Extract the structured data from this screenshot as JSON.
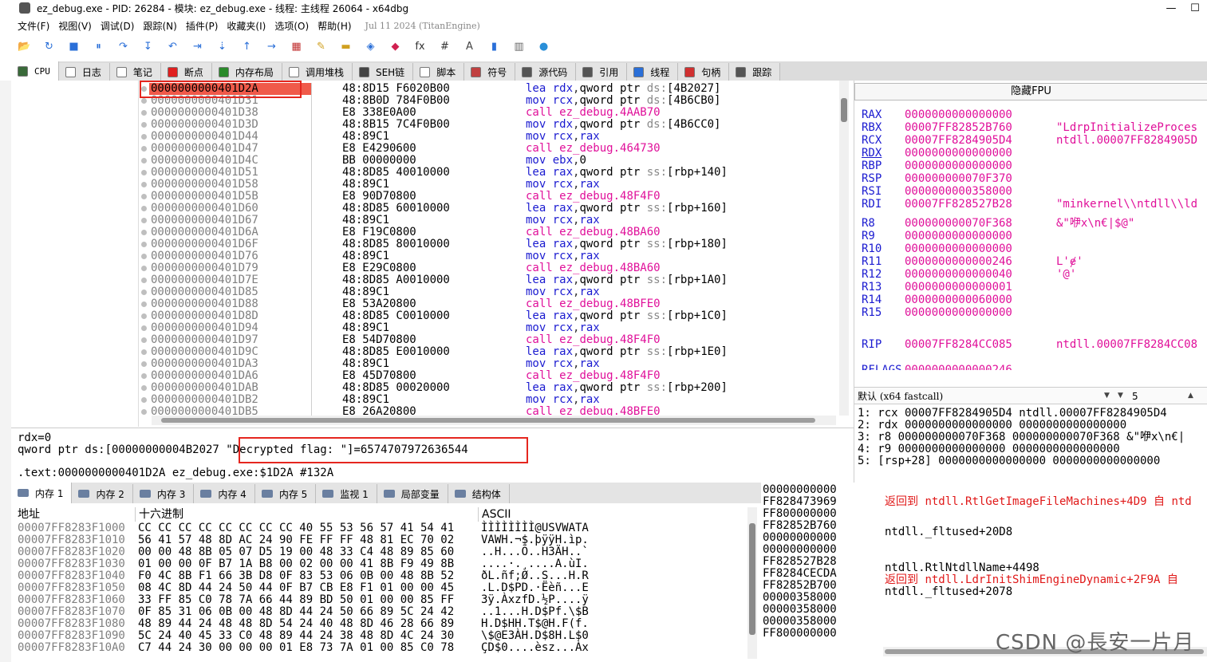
{
  "window": {
    "title": "ez_debug.exe - PID: 26284 - 模块: ez_debug.exe - 线程: 主线程 26064 - x64dbg",
    "minimize_glyph": "—",
    "maximize_glyph": "☐"
  },
  "menu": {
    "items": [
      "文件(F)",
      "视图(V)",
      "调试(D)",
      "跟踪(N)",
      "插件(P)",
      "收藏夹(I)",
      "选项(O)",
      "帮助(H)"
    ],
    "date": "Jul 11 2024 (TitanEngine)"
  },
  "toolbar": {
    "icons": [
      "open-icon",
      "restart-icon",
      "stop-icon",
      "pause-icon",
      "step-over-icon",
      "step-into-icon",
      "step-back-icon",
      "trace-over-icon",
      "trace-into-icon",
      "run-to-user-icon",
      "animate-icon",
      "patch-icon",
      "comment-icon",
      "label-icon",
      "bookmark-icon",
      "function-icon",
      "fx-icon",
      "hash-icon",
      "font-icon",
      "script-icon",
      "calc-icon",
      "globe-icon"
    ],
    "glyphs": [
      "📂",
      "↻",
      "■",
      "⏸",
      "↷",
      "↧",
      "↶",
      "⇥",
      "⇣",
      "↑",
      "→",
      "▦",
      "✎",
      "▬",
      "◈",
      "◆",
      "fx",
      "#",
      "A",
      "▮",
      "▥",
      "●"
    ],
    "colors": [
      "#d89b2a",
      "#2a6fd8",
      "#2a6fd8",
      "#2a6fd8",
      "#2a6fd8",
      "#2a6fd8",
      "#2a6fd8",
      "#2a6fd8",
      "#2a6fd8",
      "#2a6fd8",
      "#2a6fd8",
      "#c03030",
      "#d0a020",
      "#d0a020",
      "#2a6fd8",
      "#d02050",
      "#333333",
      "#333333",
      "#444444",
      "#2a6fd8",
      "#666666",
      "#2a8fd8"
    ]
  },
  "tabs": [
    {
      "label": "CPU",
      "icon": "cpu-icon",
      "color": "#3a6a3a",
      "active": true
    },
    {
      "label": "日志",
      "icon": "log-icon",
      "color": "#ffffff"
    },
    {
      "label": "笔记",
      "icon": "notes-icon",
      "color": "#ffffff"
    },
    {
      "label": "断点",
      "icon": "breakpoint-icon",
      "color": "#e02020"
    },
    {
      "label": "内存布局",
      "icon": "memory-map-icon",
      "color": "#2a8a2a"
    },
    {
      "label": "调用堆栈",
      "icon": "call-stack-icon",
      "color": "#ffffff"
    },
    {
      "label": "SEH链",
      "icon": "seh-icon",
      "color": "#444444"
    },
    {
      "label": "脚本",
      "icon": "script-icon",
      "color": "#ffffff"
    },
    {
      "label": "符号",
      "icon": "symbols-icon",
      "color": "#c04040"
    },
    {
      "label": "源代码",
      "icon": "source-icon",
      "color": "#555555"
    },
    {
      "label": "引用",
      "icon": "references-icon",
      "color": "#555555"
    },
    {
      "label": "线程",
      "icon": "threads-icon",
      "color": "#2a6fd8"
    },
    {
      "label": "句柄",
      "icon": "handles-icon",
      "color": "#d03030"
    },
    {
      "label": "跟踪",
      "icon": "trace-icon",
      "color": "#555555"
    }
  ],
  "disasm": {
    "rows": [
      {
        "addr": "0000000000401D2A",
        "bytes": "48:8D15 F6020B00",
        "op": "lea",
        "args": [
          [
            "reg",
            "rdx"
          ],
          [
            "p",
            ","
          ],
          [
            "ptr",
            "qword ptr "
          ],
          [
            "seg",
            "ds:"
          ],
          [
            "mem",
            "[4B2027]"
          ]
        ],
        "selected": true
      },
      {
        "addr": "0000000000401D31",
        "bytes": "48:8B0D 784F0B00",
        "op": "mov",
        "args": [
          [
            "reg",
            "rcx"
          ],
          [
            "p",
            ","
          ],
          [
            "ptr",
            "qword ptr "
          ],
          [
            "seg",
            "ds:"
          ],
          [
            "mem",
            "[4B6CB0]"
          ]
        ]
      },
      {
        "addr": "0000000000401D38",
        "bytes": "E8 338E0A00",
        "op": "call",
        "args": [
          [
            "tgt",
            "ez_debug.4AAB70"
          ]
        ]
      },
      {
        "addr": "0000000000401D3D",
        "bytes": "48:8B15 7C4F0B00",
        "op": "mov",
        "args": [
          [
            "reg",
            "rdx"
          ],
          [
            "p",
            ","
          ],
          [
            "ptr",
            "qword ptr "
          ],
          [
            "seg",
            "ds:"
          ],
          [
            "mem",
            "[4B6CC0]"
          ]
        ]
      },
      {
        "addr": "0000000000401D44",
        "bytes": "48:89C1",
        "op": "mov",
        "args": [
          [
            "reg",
            "rcx"
          ],
          [
            "p",
            ","
          ],
          [
            "reg",
            "rax"
          ]
        ]
      },
      {
        "addr": "0000000000401D47",
        "bytes": "E8 E4290600",
        "op": "call",
        "args": [
          [
            "tgt",
            "ez_debug.464730"
          ]
        ]
      },
      {
        "addr": "0000000000401D4C",
        "bytes": "BB 00000000",
        "op": "mov",
        "args": [
          [
            "reg",
            "ebx"
          ],
          [
            "p",
            ","
          ],
          [
            "num",
            "0"
          ]
        ]
      },
      {
        "addr": "0000000000401D51",
        "bytes": "48:8D85 40010000",
        "op": "lea",
        "args": [
          [
            "reg",
            "rax"
          ],
          [
            "p",
            ","
          ],
          [
            "ptr",
            "qword ptr "
          ],
          [
            "seg",
            "ss:"
          ],
          [
            "mem",
            "[rbp+140]"
          ]
        ]
      },
      {
        "addr": "0000000000401D58",
        "bytes": "48:89C1",
        "op": "mov",
        "args": [
          [
            "reg",
            "rcx"
          ],
          [
            "p",
            ","
          ],
          [
            "reg",
            "rax"
          ]
        ]
      },
      {
        "addr": "0000000000401D5B",
        "bytes": "E8 90D70800",
        "op": "call",
        "args": [
          [
            "tgt",
            "ez_debug.48F4F0"
          ]
        ]
      },
      {
        "addr": "0000000000401D60",
        "bytes": "48:8D85 60010000",
        "op": "lea",
        "args": [
          [
            "reg",
            "rax"
          ],
          [
            "p",
            ","
          ],
          [
            "ptr",
            "qword ptr "
          ],
          [
            "seg",
            "ss:"
          ],
          [
            "mem",
            "[rbp+160]"
          ]
        ]
      },
      {
        "addr": "0000000000401D67",
        "bytes": "48:89C1",
        "op": "mov",
        "args": [
          [
            "reg",
            "rcx"
          ],
          [
            "p",
            ","
          ],
          [
            "reg",
            "rax"
          ]
        ]
      },
      {
        "addr": "0000000000401D6A",
        "bytes": "E8 F19C0800",
        "op": "call",
        "args": [
          [
            "tgt",
            "ez_debug.48BA60"
          ]
        ]
      },
      {
        "addr": "0000000000401D6F",
        "bytes": "48:8D85 80010000",
        "op": "lea",
        "args": [
          [
            "reg",
            "rax"
          ],
          [
            "p",
            ","
          ],
          [
            "ptr",
            "qword ptr "
          ],
          [
            "seg",
            "ss:"
          ],
          [
            "mem",
            "[rbp+180]"
          ]
        ]
      },
      {
        "addr": "0000000000401D76",
        "bytes": "48:89C1",
        "op": "mov",
        "args": [
          [
            "reg",
            "rcx"
          ],
          [
            "p",
            ","
          ],
          [
            "reg",
            "rax"
          ]
        ]
      },
      {
        "addr": "0000000000401D79",
        "bytes": "E8 E29C0800",
        "op": "call",
        "args": [
          [
            "tgt",
            "ez_debug.48BA60"
          ]
        ]
      },
      {
        "addr": "0000000000401D7E",
        "bytes": "48:8D85 A0010000",
        "op": "lea",
        "args": [
          [
            "reg",
            "rax"
          ],
          [
            "p",
            ","
          ],
          [
            "ptr",
            "qword ptr "
          ],
          [
            "seg",
            "ss:"
          ],
          [
            "mem",
            "[rbp+1A0]"
          ]
        ]
      },
      {
        "addr": "0000000000401D85",
        "bytes": "48:89C1",
        "op": "mov",
        "args": [
          [
            "reg",
            "rcx"
          ],
          [
            "p",
            ","
          ],
          [
            "reg",
            "rax"
          ]
        ]
      },
      {
        "addr": "0000000000401D88",
        "bytes": "E8 53A20800",
        "op": "call",
        "args": [
          [
            "tgt",
            "ez_debug.48BFE0"
          ]
        ]
      },
      {
        "addr": "0000000000401D8D",
        "bytes": "48:8D85 C0010000",
        "op": "lea",
        "args": [
          [
            "reg",
            "rax"
          ],
          [
            "p",
            ","
          ],
          [
            "ptr",
            "qword ptr "
          ],
          [
            "seg",
            "ss:"
          ],
          [
            "mem",
            "[rbp+1C0]"
          ]
        ]
      },
      {
        "addr": "0000000000401D94",
        "bytes": "48:89C1",
        "op": "mov",
        "args": [
          [
            "reg",
            "rcx"
          ],
          [
            "p",
            ","
          ],
          [
            "reg",
            "rax"
          ]
        ]
      },
      {
        "addr": "0000000000401D97",
        "bytes": "E8 54D70800",
        "op": "call",
        "args": [
          [
            "tgt",
            "ez_debug.48F4F0"
          ]
        ]
      },
      {
        "addr": "0000000000401D9C",
        "bytes": "48:8D85 E0010000",
        "op": "lea",
        "args": [
          [
            "reg",
            "rax"
          ],
          [
            "p",
            ","
          ],
          [
            "ptr",
            "qword ptr "
          ],
          [
            "seg",
            "ss:"
          ],
          [
            "mem",
            "[rbp+1E0]"
          ]
        ]
      },
      {
        "addr": "0000000000401DA3",
        "bytes": "48:89C1",
        "op": "mov",
        "args": [
          [
            "reg",
            "rcx"
          ],
          [
            "p",
            ","
          ],
          [
            "reg",
            "rax"
          ]
        ]
      },
      {
        "addr": "0000000000401DA6",
        "bytes": "E8 45D70800",
        "op": "call",
        "args": [
          [
            "tgt",
            "ez_debug.48F4F0"
          ]
        ]
      },
      {
        "addr": "0000000000401DAB",
        "bytes": "48:8D85 00020000",
        "op": "lea",
        "args": [
          [
            "reg",
            "rax"
          ],
          [
            "p",
            ","
          ],
          [
            "ptr",
            "qword ptr "
          ],
          [
            "seg",
            "ss:"
          ],
          [
            "mem",
            "[rbp+200]"
          ]
        ]
      },
      {
        "addr": "0000000000401DB2",
        "bytes": "48:89C1",
        "op": "mov",
        "args": [
          [
            "reg",
            "rcx"
          ],
          [
            "p",
            ","
          ],
          [
            "reg",
            "rax"
          ]
        ]
      },
      {
        "addr": "0000000000401DB5",
        "bytes": "E8 26A20800",
        "op": "call",
        "args": [
          [
            "tgt",
            "ez_debug.48BFE0"
          ]
        ]
      }
    ]
  },
  "info": {
    "line1": "rdx=0",
    "line2a": "qword ptr ds:[00000000004B2027 ",
    "line2b": "\"Decrypted flag: \"]=6574707972636544",
    "line3": ".text:0000000000401D2A ez_debug.exe:$1D2A #132A"
  },
  "fpu": {
    "header": "隐藏FPU",
    "regs": [
      {
        "n": "RAX",
        "v": "0000000000000000",
        "c": ""
      },
      {
        "n": "RBX",
        "v": "00007FF82852B760",
        "c": "\"LdrpInitializeProces"
      },
      {
        "n": "RCX",
        "v": "00007FF8284905D4",
        "c": "ntdll.00007FF8284905D"
      },
      {
        "n": "RDX",
        "v": "0000000000000000",
        "c": "",
        "ul": true
      },
      {
        "n": "RBP",
        "v": "0000000000000000",
        "c": ""
      },
      {
        "n": "RSP",
        "v": "000000000070F370",
        "c": ""
      },
      {
        "n": "RSI",
        "v": "0000000000358000",
        "c": ""
      },
      {
        "n": "RDI",
        "v": "00007FF828527B28",
        "c": "\"minkernel\\\\ntdll\\\\ld"
      },
      {
        "n": "R8",
        "v": "000000000070F368",
        "c": "&\"咿x\\n€|$@\""
      },
      {
        "n": "R9",
        "v": "0000000000000000",
        "c": ""
      },
      {
        "n": "R10",
        "v": "0000000000000000",
        "c": ""
      },
      {
        "n": "R11",
        "v": "0000000000000246",
        "c": "L'ɇ'"
      },
      {
        "n": "R12",
        "v": "0000000000000040",
        "c": "'@'"
      },
      {
        "n": "R13",
        "v": "0000000000000001",
        "c": ""
      },
      {
        "n": "R14",
        "v": "0000000000060000",
        "c": ""
      },
      {
        "n": "R15",
        "v": "0000000000000000",
        "c": ""
      },
      {
        "n": "RIP",
        "v": "00007FF8284CC085",
        "c": "ntdll.00007FF8284CC08"
      },
      {
        "n": "RFLAGS",
        "v": "0000000000000246",
        "c": ""
      }
    ],
    "callconv": "默认 (x64 fastcall)",
    "argcount": "5",
    "args": [
      "1: rcx 00007FF8284905D4 ntdll.00007FF8284905D4",
      "2: rdx 0000000000000000 0000000000000000",
      "3: r8 000000000070F368 000000000070F368 &\"咿x\\n€|",
      "4: r9 0000000000000000 0000000000000000",
      "5: [rsp+28] 0000000000000000 0000000000000000"
    ]
  },
  "bottom_tabs": [
    {
      "label": "内存 1",
      "icon": "dump-icon",
      "active": true
    },
    {
      "label": "内存 2",
      "icon": "dump-icon"
    },
    {
      "label": "内存 3",
      "icon": "dump-icon"
    },
    {
      "label": "内存 4",
      "icon": "dump-icon"
    },
    {
      "label": "内存 5",
      "icon": "dump-icon"
    },
    {
      "label": "监视 1",
      "icon": "watch-icon"
    },
    {
      "label": "局部变量",
      "icon": "locals-icon"
    },
    {
      "label": "结构体",
      "icon": "struct-icon"
    }
  ],
  "dump": {
    "headers": [
      "地址",
      "十六进制",
      "ASCII"
    ],
    "rows": [
      {
        "a": "00007FF8283F1000",
        "h": "CC CC CC CC CC CC CC CC 40 55 53 56 57 41 54 41",
        "c": "ÌÌÌÌÌÌÌÌ@USVWATA"
      },
      {
        "a": "00007FF8283F1010",
        "h": "56 41 57 48 8D AC 24 90 FE FF FF 48 81 EC 70 02",
        "c": "VAWH.¬$.þÿÿH.ìp."
      },
      {
        "a": "00007FF8283F1020",
        "h": "00 00 48 8B 05 07 D5 19 00 48 33 C4 48 89 85 60",
        "c": "..H...Õ..H3ÄH..`"
      },
      {
        "a": "00007FF8283F1030",
        "h": "01 00 00 0F B7 1A B8 00 02 00 00 41 8B F9 49 8B",
        "c": "....·.¸....A.ùI."
      },
      {
        "a": "00007FF8283F1040",
        "h": "F0 4C 8B F1 66 3B D8 0F 83 53 06 0B 00 48 8B 52",
        "c": "ðL.ñf;Ø..S...H.R"
      },
      {
        "a": "00007FF8283F1050",
        "h": "08 4C 8D 44 24 50 44 0F B7 CB E8 F1 01 00 00 45",
        "c": ".L.D$PD.·Ëèñ...E"
      },
      {
        "a": "00007FF8283F1060",
        "h": "33 FF 85 C0 78 7A 66 44 89 BD 50 01 00 00 85 FF",
        "c": "3ÿ.ÀxzfD.½P....ÿ"
      },
      {
        "a": "00007FF8283F1070",
        "h": "0F 85 31 06 0B 00 48 8D 44 24 50 66 89 5C 24 42",
        "c": "..1...H.D$Pf.\\$B"
      },
      {
        "a": "00007FF8283F1080",
        "h": "48 89 44 24 48 48 8D 54 24 40 48 8D 46 28 66 89",
        "c": "H.D$HH.T$@H.F(f."
      },
      {
        "a": "00007FF8283F1090",
        "h": "5C 24 40 45 33 C0 48 89 44 24 38 48 8D 4C 24 30",
        "c": "\\$@E3ÀH.D$8H.L$0"
      },
      {
        "a": "00007FF8283F10A0",
        "h": "C7 44 24 30 00 00 00 01 E8 73 7A 01 00 85 C0 78",
        "c": "ÇD$0....èsz...Àx"
      }
    ]
  },
  "stack": {
    "rows": [
      "00000000000",
      "FF828473969",
      "FF800000000",
      "FF82852B760",
      "00000000000",
      "00000000000",
      "FF828527B28",
      "FF8284CECDA",
      "FF82852B700",
      "00000358000",
      "00000358000",
      "00000358000",
      "FF800000000"
    ],
    "comments": [
      {
        "row": 1,
        "ret": "返回到",
        "text": "ntdll.RtlGetImageFileMachines+4D9 自 ntd"
      },
      {
        "row": 3,
        "ret": "",
        "text": "ntdll._fltused+20D8"
      },
      {
        "row": 6,
        "ret": "",
        "text": "ntdll.RtlNtdllName+4498"
      },
      {
        "row": 7,
        "ret": "返回到",
        "text": "ntdll.LdrInitShimEngineDynamic+2F9A 自"
      },
      {
        "row": 8,
        "ret": "",
        "text": "ntdll._fltused+2078"
      }
    ]
  },
  "watermark": "CSDN @長安一片月"
}
